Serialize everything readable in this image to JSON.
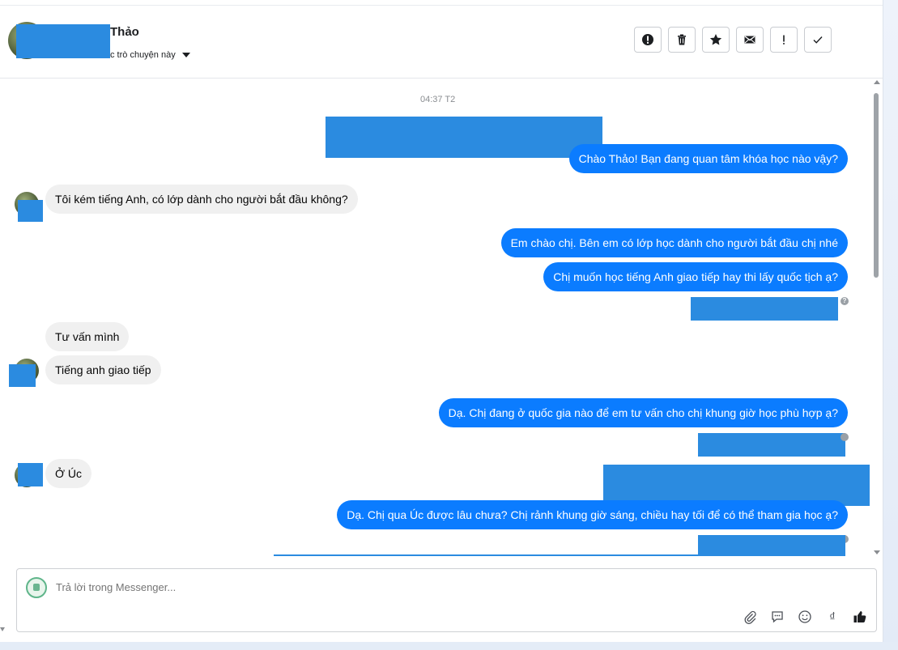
{
  "header": {
    "name_suffix": "Thảo",
    "subtitle_suffix": "c trò chuyện này",
    "actions": [
      "spam-report",
      "delete",
      "star",
      "mark-unread",
      "important",
      "done"
    ]
  },
  "chat": {
    "timestamp": "04:37 T2",
    "messages": {
      "m1": "Chào Thảo! Bạn đang quan tâm khóa học nào vậy?",
      "m2": "Tôi kém tiếng Anh, có lớp dành cho người bắt đầu không?",
      "m3": "Em chào chị. Bên em có lớp học dành cho người bắt đầu chị nhé",
      "m4": "Chị muốn học tiếng Anh giao tiếp hay thi lấy quốc tịch ạ?",
      "m5": "Tư vấn mình",
      "m6": "Tiếng anh giao tiếp",
      "m7": "Dạ. Chị đang ở quốc gia nào để em tư vấn cho chị khung giờ học phù hợp ạ?",
      "m8": "Ở Úc",
      "m9": "Dạ. Chị qua Úc được lâu chưa? Chị rảnh khung giờ sáng, chiều hay tối để có thể tham gia học ạ?"
    }
  },
  "composer": {
    "placeholder": "Trả lời trong Messenger...",
    "icons": [
      "attachment-icon",
      "saved-reply-icon",
      "emoji-icon",
      "dong-currency-icon",
      "like-icon"
    ],
    "currency_glyph": "₫"
  },
  "colors": {
    "outgoing": "#0b7cff",
    "incoming": "#f0f0f0",
    "redaction": "#2b8be0"
  }
}
